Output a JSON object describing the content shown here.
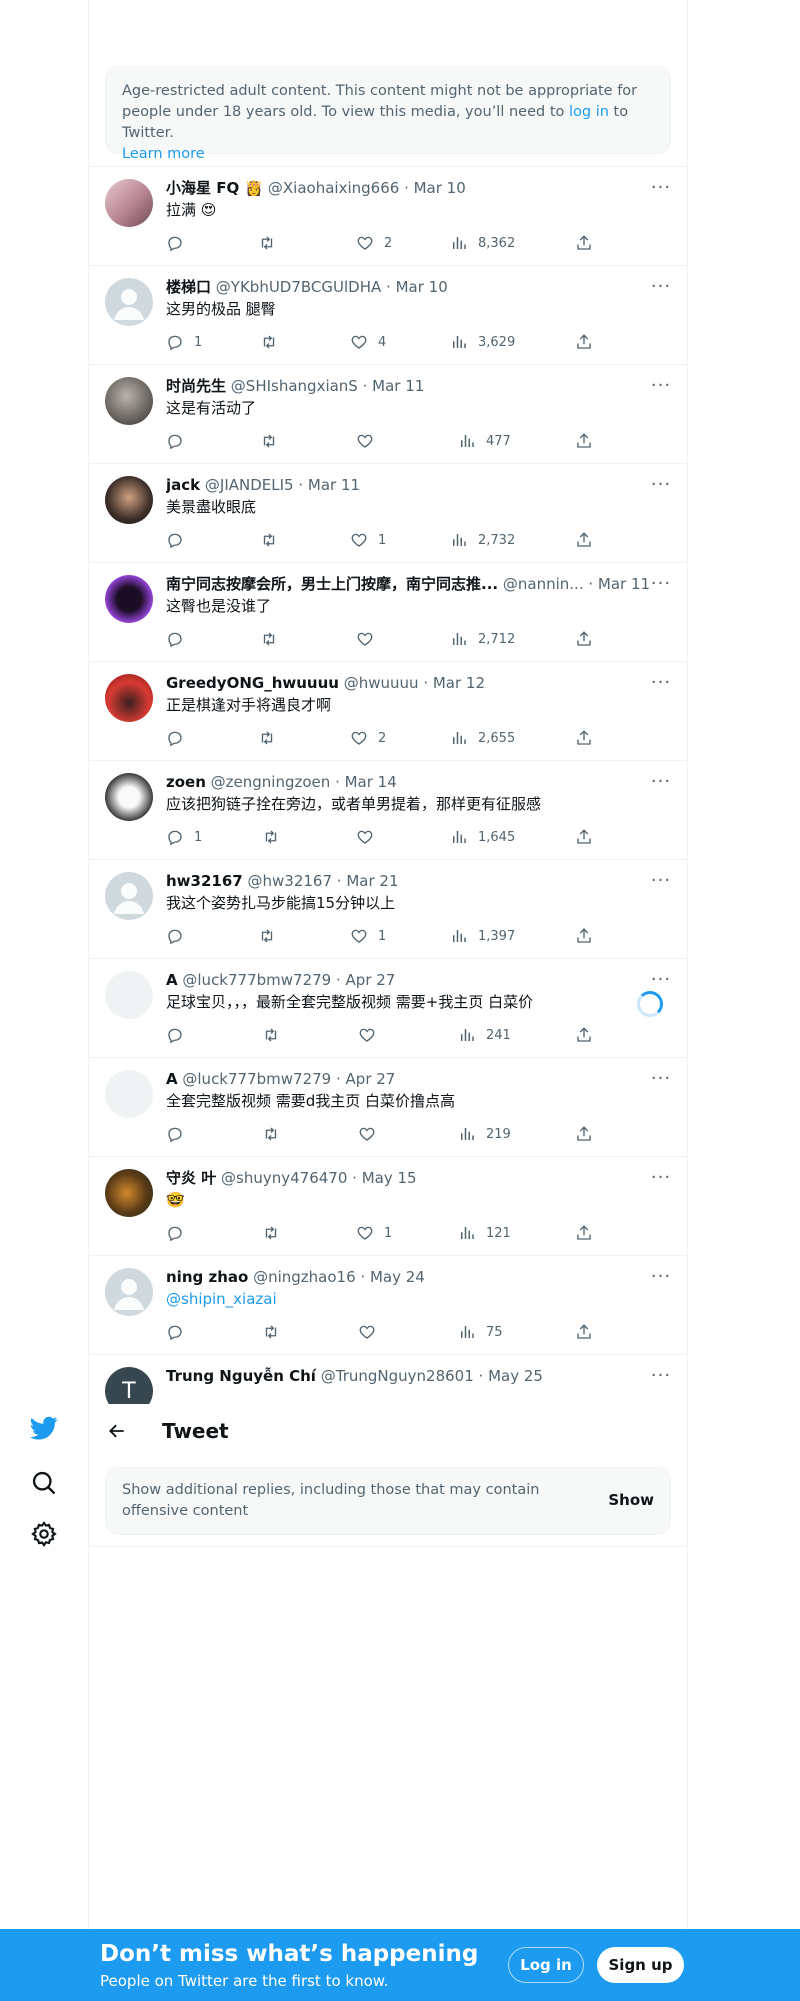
{
  "nav": {
    "icons": [
      "twitter-bird-icon",
      "search-icon",
      "settings-icon"
    ]
  },
  "notice": {
    "text_before": "Age-restricted adult content. This content might not be appropriate for people under 18 years old. To view this media, you’ll need to ",
    "login_link": "log in",
    "text_after": " to Twitter.",
    "learn_more": "Learn more"
  },
  "tweets": [
    {
      "name": "小海星 FQ 👸",
      "handle": "@Xiaohaixing666",
      "date": "· Mar 10",
      "text": "拉满 😍",
      "replies": "",
      "likes": "2",
      "views": "8,362"
    },
    {
      "name": "楼梯口",
      "handle": "@YKbhUD7BCGUlDHA",
      "date": "· Mar 10",
      "text": "这男的极品 腿臀",
      "replies": "1",
      "likes": "4",
      "views": "3,629"
    },
    {
      "name": "时尚先生",
      "handle": "@SHIshangxianS",
      "date": "· Mar 11",
      "text": "这是有活动了",
      "replies": "",
      "likes": "",
      "views": "477"
    },
    {
      "name": "jack",
      "handle": "@JIANDELI5",
      "date": "· Mar 11",
      "text": "美景盡收眼底",
      "replies": "",
      "likes": "1",
      "views": "2,732"
    },
    {
      "name": "南宁同志按摩会所，男士上门按摩，南宁同志推...",
      "handle": "@nannin...",
      "date": "· Mar 11",
      "text": "这臀也是没谁了",
      "replies": "",
      "likes": "",
      "views": "2,712"
    },
    {
      "name": "GreedyONG_hwuuuu",
      "handle": "@hwuuuu",
      "date": "· Mar 12",
      "text": "正是棋逢对手将遇良才啊",
      "replies": "",
      "likes": "2",
      "views": "2,655"
    },
    {
      "name": "zoen",
      "handle": "@zengningzoen",
      "date": "· Mar 14",
      "text": "应该把狗链子拴在旁边，或者单男提着，那样更有征服感",
      "replies": "1",
      "likes": "",
      "views": "1,645"
    },
    {
      "name": "hw32167",
      "handle": "@hw32167",
      "date": "· Mar 21",
      "text": "我这个姿势扎马步能搞15分钟以上",
      "replies": "",
      "likes": "1",
      "views": "1,397"
    },
    {
      "name": "A",
      "handle": "@luck777bmw7279",
      "date": "· Apr 27",
      "text": "足球宝贝，，，最新全套完整版视频 需要+我主页 白菜价",
      "replies": "",
      "likes": "",
      "views": "241"
    },
    {
      "name": "A",
      "handle": "@luck777bmw7279",
      "date": "· Apr 27",
      "text": "全套完整版视频 需要d我主页 白菜价撸点高",
      "replies": "",
      "likes": "",
      "views": "219"
    },
    {
      "name": "守炎 叶",
      "handle": "@shuyny476470",
      "date": "· May 15",
      "text": "🤓",
      "replies": "",
      "likes": "1",
      "views": "121"
    },
    {
      "name": "ning zhao",
      "handle": "@ningzhao16",
      "date": "· May 24",
      "text": "@shipin_xiazai",
      "replies": "",
      "likes": "",
      "views": "75"
    },
    {
      "name": "Trung Nguyễn Chí",
      "handle": "@TrungNguyn28601",
      "date": "· May 25",
      "text": "",
      "replies": "",
      "likes": "",
      "views": "",
      "avatar_letter": "T"
    }
  ],
  "more_glyph": "···",
  "header": {
    "title": "Tweet"
  },
  "offensive": {
    "message": "Show additional replies, including those that may contain offensive content",
    "show": "Show"
  },
  "banner": {
    "title": "Don’t miss what’s happening",
    "subtitle": "People on Twitter are the first to know.",
    "login": "Log in",
    "signup": "Sign up"
  },
  "colors": {
    "accent": "#1d9bf0",
    "text": "#0f1419",
    "muted": "#536471",
    "border": "#eff3f4"
  }
}
